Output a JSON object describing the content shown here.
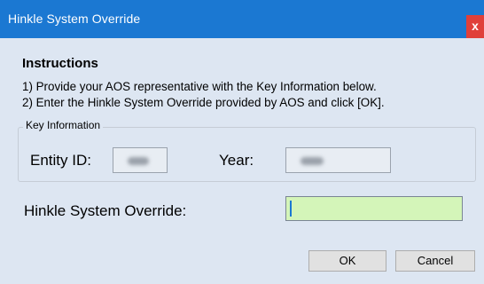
{
  "window": {
    "title": "Hinkle System Override",
    "close_glyph": "x",
    "close_icon": "close-icon"
  },
  "instructions": {
    "heading": "Instructions",
    "line1": "1) Provide your AOS representative with the Key Information below.",
    "line2": "2) Enter the Hinkle System Override provided by AOS and click [OK]."
  },
  "key_info": {
    "legend": "Key Information",
    "entity_label": "Entity ID:",
    "year_label": "Year:"
  },
  "override": {
    "label": "Hinkle System Override:",
    "value": ""
  },
  "buttons": {
    "ok": "OK",
    "cancel": "Cancel"
  },
  "colors": {
    "titlebar": "#1b78d2",
    "close": "#e0403a",
    "dialog_bg": "#dde6f2",
    "override_field": "#d4f5b9"
  }
}
